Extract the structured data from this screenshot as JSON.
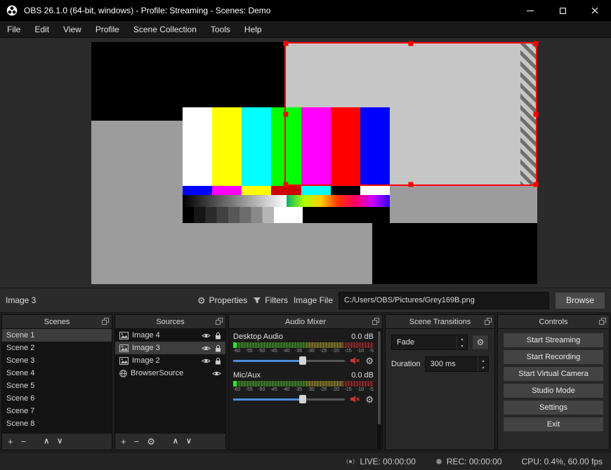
{
  "colors": {
    "selection_border": "#ff0000",
    "slider_fill": "#4a90d9",
    "mute_icon": "#cc3333",
    "meter_live_green": "#2ee62e",
    "canvas_background": "#9c9c9c",
    "titlebar_background": "#000000"
  },
  "icons": {
    "add": "+",
    "remove": "−",
    "move_up": "∧",
    "move_down": "∨",
    "gear": "⚙",
    "spin_up": "▴",
    "spin_down": "▾"
  },
  "window": {
    "title": "OBS 26.1.0 (64-bit, windows) - Profile: Streaming - Scenes: Demo"
  },
  "menu": {
    "items": [
      "File",
      "Edit",
      "View",
      "Profile",
      "Scene Collection",
      "Tools",
      "Help"
    ]
  },
  "source_toolbar": {
    "selected_source": "Image 3",
    "properties": "Properties",
    "filters": "Filters",
    "image_file_label": "Image File",
    "image_file_path": "C:/Users/OBS/Pictures/Grey169B.png",
    "browse": "Browse"
  },
  "scenes_panel": {
    "title": "Scenes",
    "items": [
      "Scene 1",
      "Scene 2",
      "Scene 3",
      "Scene 4",
      "Scene 5",
      "Scene 6",
      "Scene 7",
      "Scene 8"
    ],
    "selected": "Scene 1"
  },
  "sources_panel": {
    "title": "Sources",
    "items": [
      {
        "name": "Image 4",
        "icon": "image-icon"
      },
      {
        "name": "Image 3",
        "icon": "image-icon"
      },
      {
        "name": "Image 2",
        "icon": "image-icon"
      },
      {
        "name": "BrowserSource",
        "icon": "globe-icon"
      }
    ],
    "selected": "Image 3"
  },
  "audio_mixer": {
    "title": "Audio Mixer",
    "channels": [
      {
        "name": "Desktop Audio",
        "db": "0.0 dB",
        "muted": true,
        "scale": [
          "-60",
          "-55",
          "-50",
          "-45",
          "-40",
          "-35",
          "-30",
          "-25",
          "-20",
          "-15",
          "-10",
          "-5"
        ]
      },
      {
        "name": "Mic/Aux",
        "db": "0.0 dB",
        "muted": true,
        "scale": [
          "-60",
          "-55",
          "-50",
          "-45",
          "-40",
          "-35",
          "-30",
          "-25",
          "-20",
          "-15",
          "-10",
          "-5"
        ]
      }
    ]
  },
  "transitions_panel": {
    "title": "Scene Transitions",
    "selected_transition": "Fade",
    "duration_label": "Duration",
    "duration_value": "300 ms"
  },
  "controls_panel": {
    "title": "Controls",
    "buttons": [
      "Start Streaming",
      "Start Recording",
      "Start Virtual Camera",
      "Studio Mode",
      "Settings",
      "Exit"
    ]
  },
  "statusbar": {
    "live": "LIVE: 00:00:00",
    "rec": "REC: 00:00:00",
    "cpu": "CPU: 0.4%, 60.00 fps"
  },
  "preview_scene": {
    "colorbar_colors": [
      "#ffffff",
      "#ffff00",
      "#00ffff",
      "#00ff00",
      "#ff00ff",
      "#ff0000",
      "#0000ff"
    ],
    "reversed_bar_colors": [
      "#0000ff",
      "#ff00ff",
      "#ffff00",
      "#cc0000",
      "#00ffff",
      "#000000",
      "#ffffff"
    ]
  }
}
